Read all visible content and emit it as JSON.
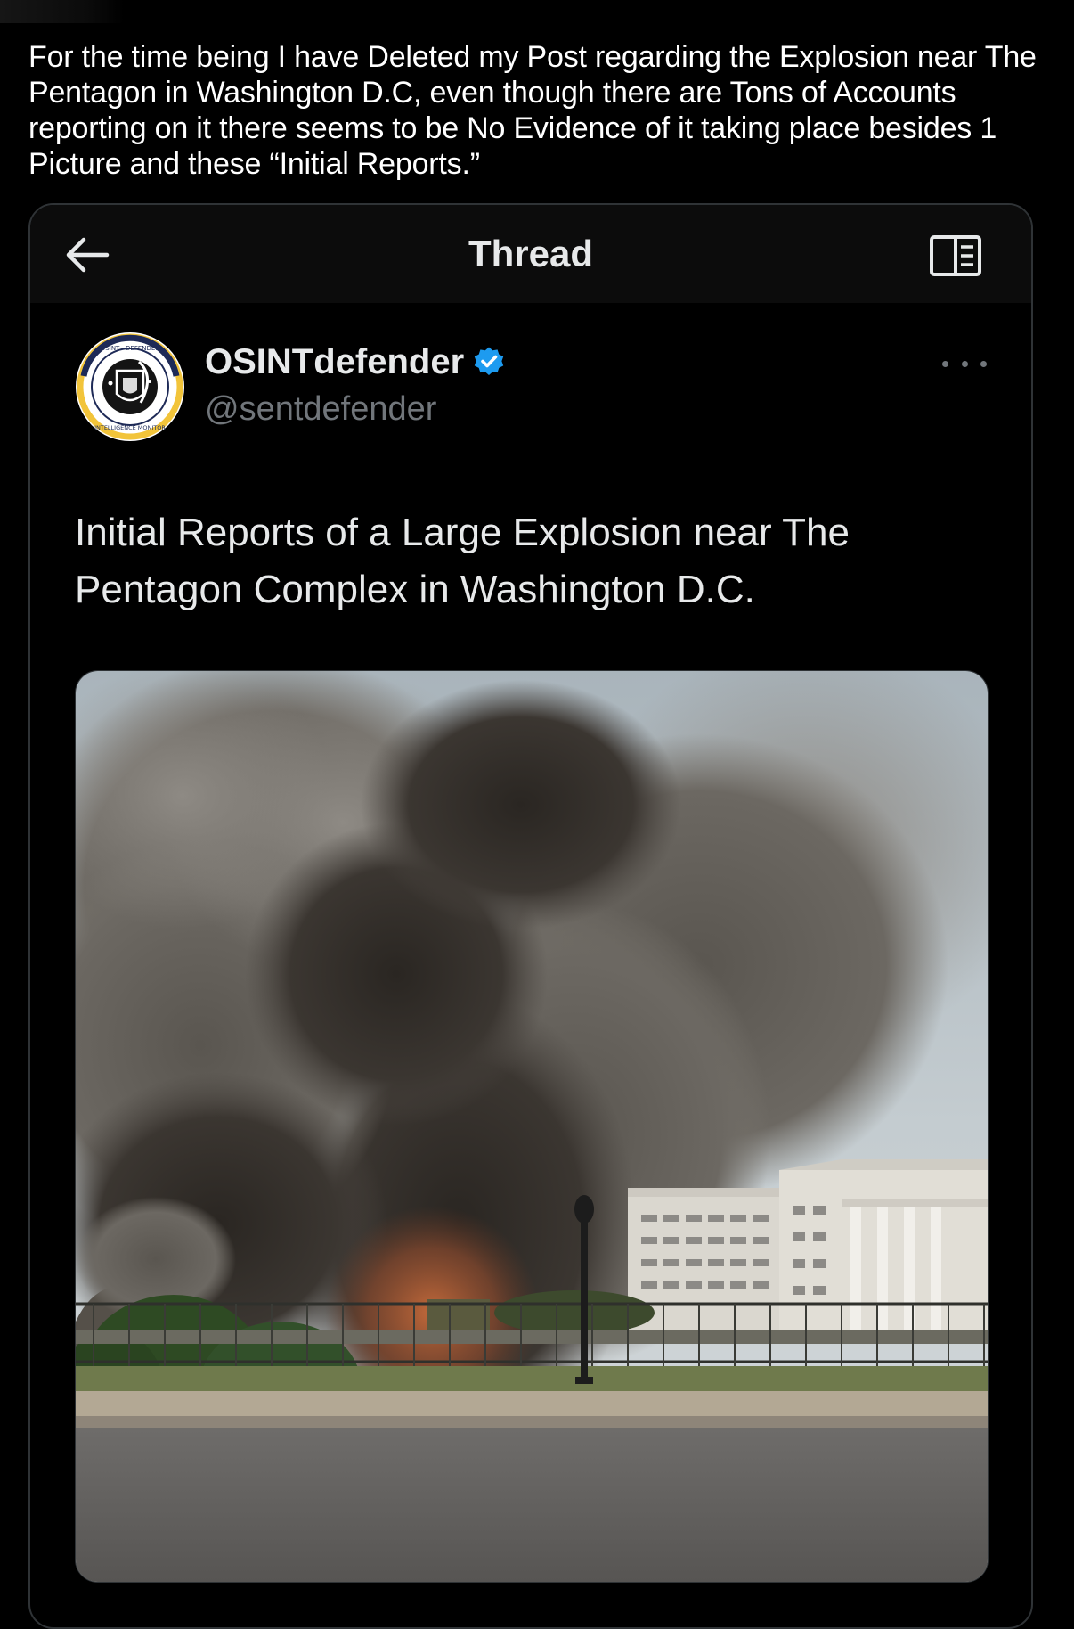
{
  "caption": "For the time being I have Deleted my Post regarding the Explosion near The Pentagon in Washington D.C, even though there are Tons of Accounts reporting on it there seems to be No Evidence of it taking place besides 1 Picture and these “Initial Reports.”",
  "thread_header": {
    "title": "Thread",
    "back_icon": "arrow-left-icon",
    "reader_icon": "book-open-icon"
  },
  "tweet": {
    "author": {
      "display_name": "OSINTdefender",
      "handle": "@sentdefender",
      "verified": true,
      "avatar_ring_text_top": "OSINT · DEFENDER",
      "avatar_ring_text_bottom": "INTELLIGENCE MONITOR"
    },
    "text": "Initial Reports of a Large Explosion near The Pentagon Complex in Washington D.C.",
    "media_alt": "photo of dark smoke rising near a large government building"
  },
  "colors": {
    "background": "#000000",
    "text_primary": "#e7e9ea",
    "text_secondary": "#71767b",
    "border": "#2f3336",
    "verified_blue": "#1d9bf0",
    "avatar_gold": "#f2c43a",
    "avatar_navy": "#1e2a57"
  }
}
